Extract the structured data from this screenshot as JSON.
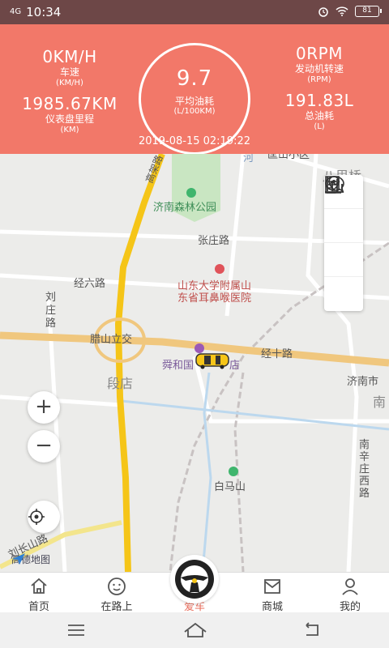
{
  "status_bar": {
    "signal": "4G",
    "time": "10:34",
    "battery": "81"
  },
  "dashboard": {
    "speed": {
      "value": "0KM/H",
      "label": "车速",
      "unit": "(KM/H)"
    },
    "odometer": {
      "value": "1985.67KM",
      "label": "仪表盘里程",
      "unit": "(KM)"
    },
    "rpm": {
      "value": "0RPM",
      "label": "发动机转速",
      "unit": "(RPM)"
    },
    "total_fuel": {
      "value": "191.83L",
      "label": "总油耗",
      "unit": "(L)"
    },
    "avg_fuel": {
      "value": "9.7",
      "label": "平均油耗",
      "unit": "(L/100KM)"
    },
    "timestamp": "2019-08-15 02:19:22"
  },
  "map": {
    "labels": {
      "forest_park": "济南森林公园",
      "zhangzhuang": "张庄路",
      "jingliu": "经六路",
      "liuzhuang": "刘\n庄\n路",
      "hospital_1": "山东大学附属山",
      "hospital_2": "东省耳鼻喉医院",
      "lashan": "腊山立交",
      "jingshi": "经十路",
      "shunhe": "舜和国",
      "shunhe2": "店",
      "duandian": "段店",
      "baimashan": "白马山",
      "jinan": "济南市",
      "nan": "南",
      "nanxin": "南\n辛\n庄\n西\n路",
      "liuchangshan": "刘长山路",
      "gaojia": "高架路",
      "bali": "八里桥",
      "top_cut": "匡山小区",
      "he": "河"
    },
    "zoom_in": "+",
    "zoom_out": "−",
    "logo": "高德地图",
    "accent_road": "#f5c518"
  },
  "tabs": [
    {
      "label": "首页",
      "icon": "home-icon"
    },
    {
      "label": "在路上",
      "icon": "face-icon"
    },
    {
      "label": "爱车",
      "icon": "steering-wheel-icon"
    },
    {
      "label": "商城",
      "icon": "mall-icon"
    },
    {
      "label": "我的",
      "icon": "person-icon"
    }
  ],
  "colors": {
    "header": "#f27869",
    "active_tab": "#e96f5e",
    "status_bar": "#6d4747"
  }
}
